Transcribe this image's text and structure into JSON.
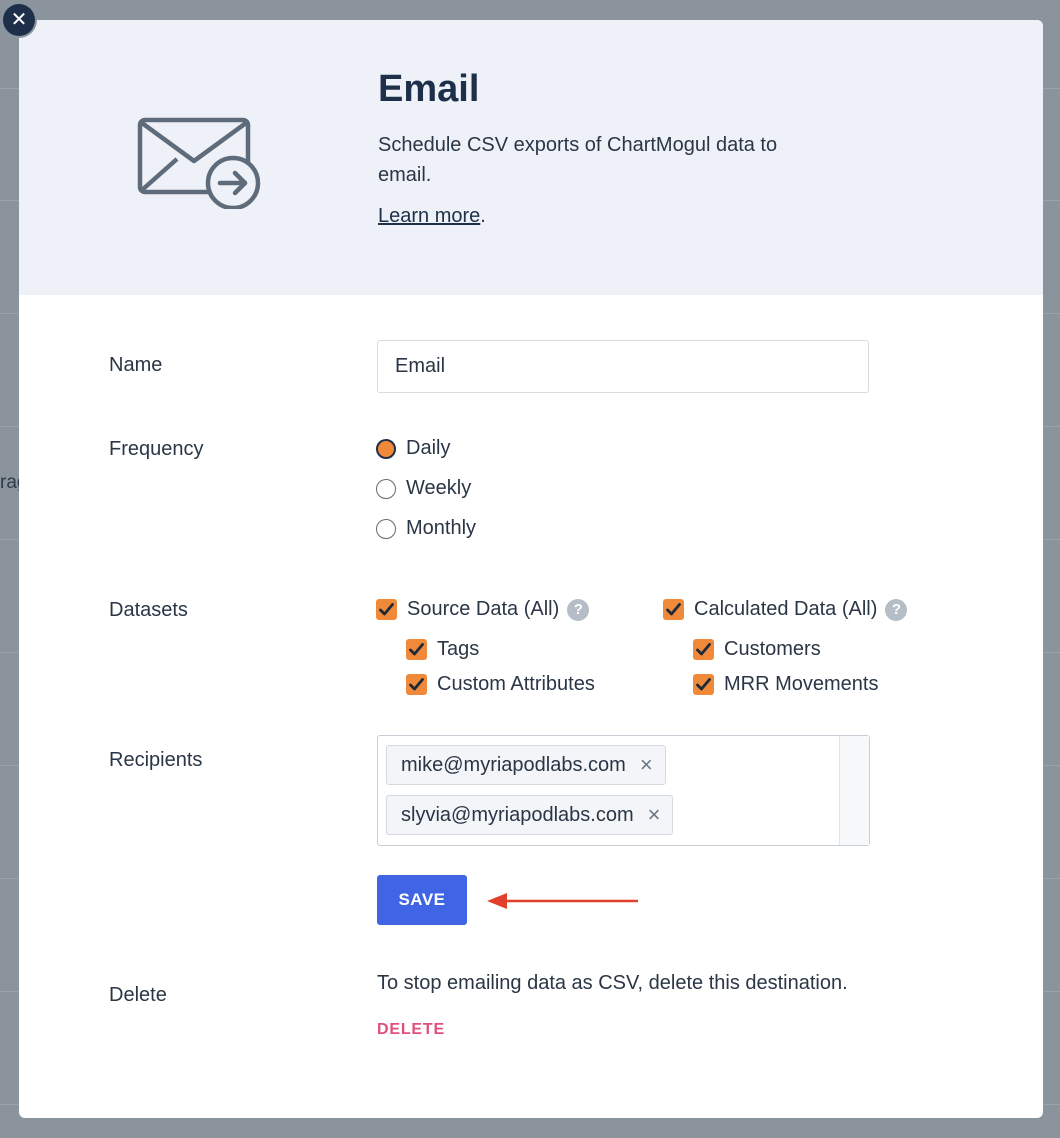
{
  "background": {
    "fragment": "rag"
  },
  "modal": {
    "close_symbol": "✕",
    "title": "Email",
    "description": "Schedule CSV exports of ChartMogul data to email.",
    "learn_more": "Learn more",
    "learn_more_suffix": ".",
    "header_icon": "email-send-icon"
  },
  "form": {
    "name": {
      "label": "Name",
      "value": "Email"
    },
    "frequency": {
      "label": "Frequency",
      "options": [
        "Daily",
        "Weekly",
        "Monthly"
      ],
      "selected": "Daily"
    },
    "datasets": {
      "label": "Datasets",
      "source": {
        "label": "Source Data (All)",
        "checked": true,
        "children": [
          "Tags",
          "Custom Attributes"
        ]
      },
      "calculated": {
        "label": "Calculated Data (All)",
        "checked": true,
        "children": [
          "Customers",
          "MRR Movements"
        ]
      },
      "help_symbol": "?"
    },
    "recipients": {
      "label": "Recipients",
      "emails": [
        "mike@myriapodlabs.com",
        "slyvia@myriapodlabs.com"
      ],
      "remove_symbol": "×"
    },
    "save_label": "SAVE",
    "delete": {
      "label": "Delete",
      "text": "To stop emailing data as CSV, delete this destination.",
      "link": "DELETE"
    }
  },
  "colors": {
    "accent_orange": "#f0893a",
    "primary_blue": "#3f64e4",
    "navy": "#1e3049",
    "danger_pink": "#e0507a",
    "annotation_red": "#e2402a"
  }
}
